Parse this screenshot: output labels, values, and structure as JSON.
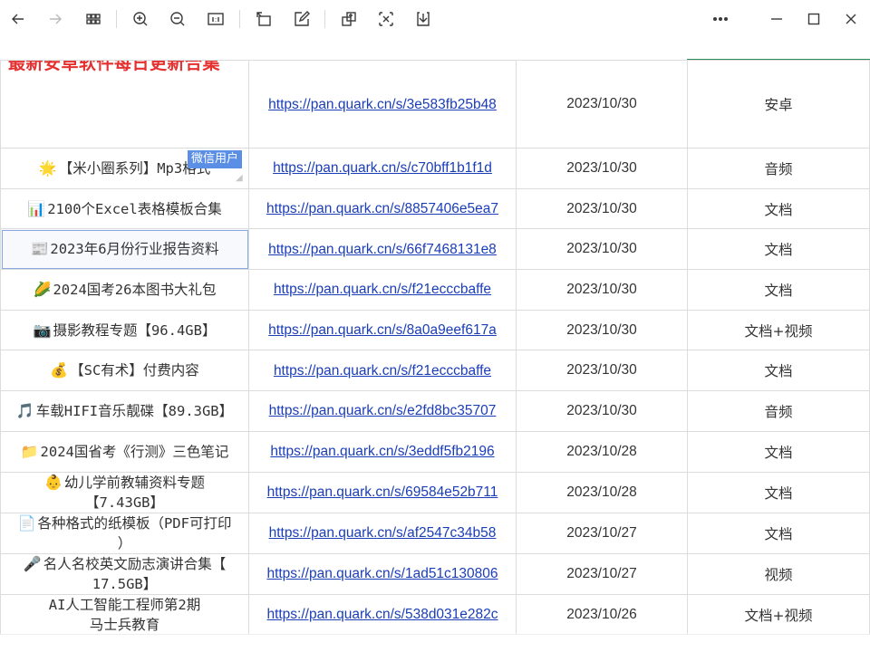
{
  "toolbar": {
    "icons": [
      "back-arrow-icon",
      "forward-arrow-icon",
      "grid-view-icon",
      "zoom-in-icon",
      "zoom-out-icon",
      "actual-size-icon",
      "rotate-icon",
      "edit-icon",
      "crop-icon",
      "translate-icon",
      "download-icon",
      "more-icon",
      "minimize-icon",
      "maximize-icon",
      "close-icon"
    ]
  },
  "sheet": {
    "title": "最新安卓软件每日更新合集",
    "rows": [
      {
        "icon": "",
        "name": "",
        "link": "https://pan.quark.cn/s/3e583fb25b48",
        "date": "2023/10/30",
        "type": "安卓"
      },
      {
        "icon": "🌟",
        "name": "【米小圈系列】Mp3格式",
        "link": "https://pan.quark.cn/s/c70bff1b1f1d",
        "date": "2023/10/30",
        "type": "音频"
      },
      {
        "icon": "📊",
        "name": "2100个Excel表格模板合集",
        "link": "https://pan.quark.cn/s/8857406e5ea7",
        "date": "2023/10/30",
        "type": "文档"
      },
      {
        "icon": "📰",
        "name": "2023年6月份行业报告资料",
        "link": "https://pan.quark.cn/s/66f7468131e8",
        "date": "2023/10/30",
        "type": "文档"
      },
      {
        "icon": "🌽",
        "name": "2024国考26本图书大礼包",
        "link": "https://pan.quark.cn/s/f21ecccbaffe",
        "date": "2023/10/30",
        "type": "文档"
      },
      {
        "icon": "📷",
        "name": "摄影教程专题【96.4GB】",
        "link": "https://pan.quark.cn/s/8a0a9eef617a",
        "date": "2023/10/30",
        "type": "文档+视频"
      },
      {
        "icon": "💰",
        "name": "【SC有术】付费内容",
        "link": "https://pan.quark.cn/s/f21ecccbaffe",
        "date": "2023/10/30",
        "type": "文档"
      },
      {
        "icon": "🎵",
        "name": "车载HIFI音乐靓碟【89.3GB】",
        "link": "https://pan.quark.cn/s/e2fd8bc35707",
        "date": "2023/10/30",
        "type": "音频"
      },
      {
        "icon": "📁",
        "name": "2024国省考《行测》三色笔记",
        "link": "https://pan.quark.cn/s/3eddf5fb2196",
        "date": "2023/10/28",
        "type": "文档"
      },
      {
        "icon": "👶",
        "name": "幼儿学前教辅资料专题",
        "name2": "【7.43GB】",
        "link": "https://pan.quark.cn/s/69584e52b711",
        "date": "2023/10/28",
        "type": "文档"
      },
      {
        "icon": "📄",
        "name": "各种格式的纸模板（PDF可打印",
        "name2": "）",
        "link": "https://pan.quark.cn/s/af2547c34b58",
        "date": "2023/10/27",
        "type": "文档"
      },
      {
        "icon": "🎤",
        "name": "名人名校英文励志演讲合集【",
        "name2": "17.5GB】",
        "link": "https://pan.quark.cn/s/1ad51c130806",
        "date": "2023/10/27",
        "type": "视频"
      },
      {
        "icon": "",
        "name": "AI人工智能工程师第2期",
        "name2": "马士兵教育",
        "link": "https://pan.quark.cn/s/538d031e282c",
        "date": "2023/10/26",
        "type": "文档+视频"
      }
    ],
    "comment_tag": "微信用户"
  }
}
